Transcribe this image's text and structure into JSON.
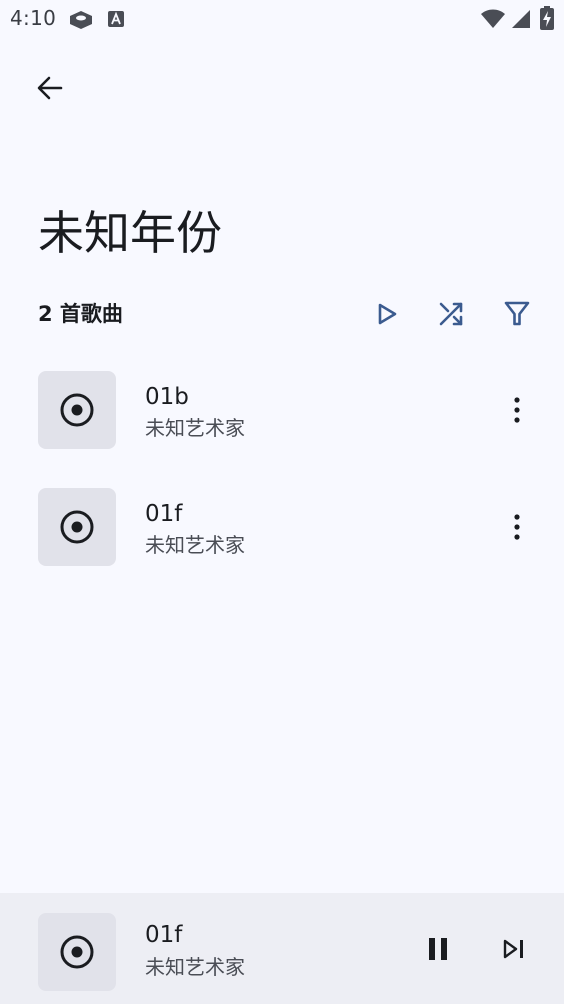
{
  "status_bar": {
    "time": "4:10",
    "icons": [
      "notification-box-icon",
      "keyboard-a-icon",
      "wifi-icon",
      "signal-icon",
      "battery-charging-icon"
    ]
  },
  "header": {
    "back_icon": "arrow-back-icon",
    "title": "未知年份",
    "song_count": "2 首歌曲",
    "actions": [
      {
        "name": "play-all-button",
        "icon": "play-icon"
      },
      {
        "name": "shuffle-button",
        "icon": "shuffle-icon"
      },
      {
        "name": "filter-button",
        "icon": "filter-icon"
      }
    ]
  },
  "songs": [
    {
      "title": "01b",
      "artist": "未知艺术家"
    },
    {
      "title": "01f",
      "artist": "未知艺术家"
    }
  ],
  "mini_player": {
    "title": "01f",
    "artist": "未知艺术家",
    "controls": [
      "pause-icon",
      "skip-next-icon"
    ]
  },
  "colors": {
    "background": "#f8f9ff",
    "accent": "#3b5b8f",
    "thumb_bg": "#e1e2ea",
    "mini_player_bg": "#edeef4"
  }
}
